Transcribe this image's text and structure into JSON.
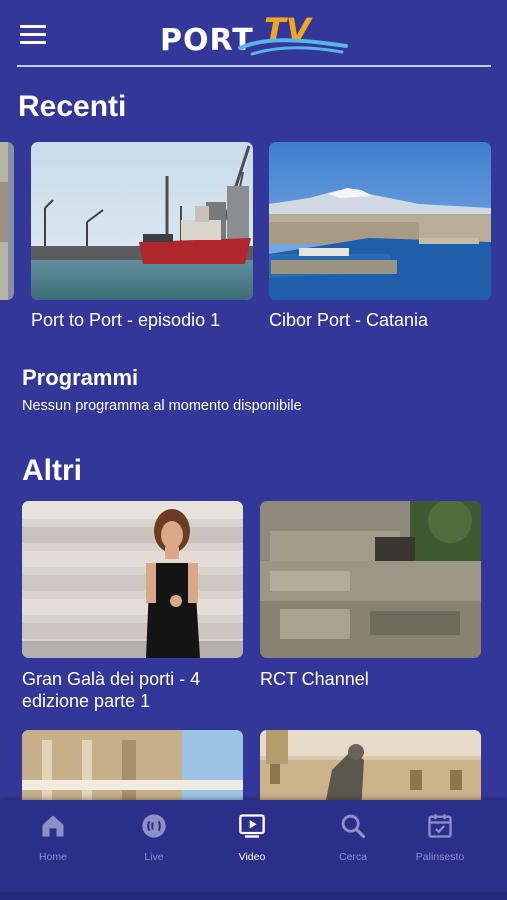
{
  "header": {
    "logo_port": "PORT",
    "logo_tv": "TV",
    "accent_color": "#f3a51f"
  },
  "recenti": {
    "title": "Recenti",
    "items": [
      {
        "caption": "Port to Port - episodio 1"
      },
      {
        "caption": "Cibor Port - Catania"
      }
    ]
  },
  "programmi": {
    "title": "Programmi",
    "text": "Nessun programma al momento disponibile"
  },
  "altri": {
    "title": "Altri",
    "items": [
      {
        "caption": "Gran Galà dei porti - 4 edizione parte 1"
      },
      {
        "caption": "RCT Channel"
      },
      {
        "caption": ""
      },
      {
        "caption": ""
      }
    ]
  },
  "nav": {
    "items": [
      {
        "label": "Home",
        "icon": "home-icon"
      },
      {
        "label": "Live",
        "icon": "live-icon"
      },
      {
        "label": "Video",
        "icon": "video-icon",
        "active": true
      },
      {
        "label": "Cerca",
        "icon": "search-icon"
      },
      {
        "label": "Palinsesto",
        "icon": "calendar-icon"
      }
    ]
  },
  "colors": {
    "background": "#34379a",
    "nav_background": "#2c2f8a",
    "nav_inactive": "#8d8fc8",
    "nav_active": "#ffffff"
  }
}
